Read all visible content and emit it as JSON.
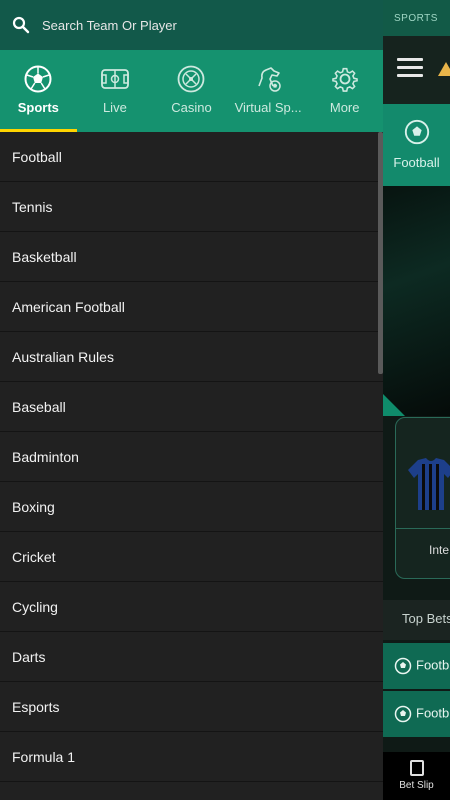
{
  "search": {
    "placeholder": "Search Team Or Player"
  },
  "tabs": [
    {
      "label": "Sports",
      "icon": "soccer-ball-icon",
      "active": true
    },
    {
      "label": "Live",
      "icon": "pitch-icon",
      "active": false
    },
    {
      "label": "Casino",
      "icon": "roulette-icon",
      "active": false
    },
    {
      "label": "Virtual Sp...",
      "icon": "horse-icon",
      "active": false
    },
    {
      "label": "More",
      "icon": "gear-icon",
      "active": false
    }
  ],
  "sports": [
    "Football",
    "Tennis",
    "Basketball",
    "American Football",
    "Australian Rules",
    "Baseball",
    "Badminton",
    "Boxing",
    "Cricket",
    "Cycling",
    "Darts",
    "Esports",
    "Formula 1"
  ],
  "background": {
    "top_label": "SPORTS",
    "tab_label": "Football",
    "card_label": "Inte",
    "top_bets": "Top Bets",
    "rows": [
      "Footb",
      "Footb"
    ],
    "bet_slip": "Bet Slip"
  },
  "colors": {
    "accent": "#15926f",
    "search_bg": "#12594a",
    "indicator": "#ffd400",
    "list_bg": "#212121"
  }
}
